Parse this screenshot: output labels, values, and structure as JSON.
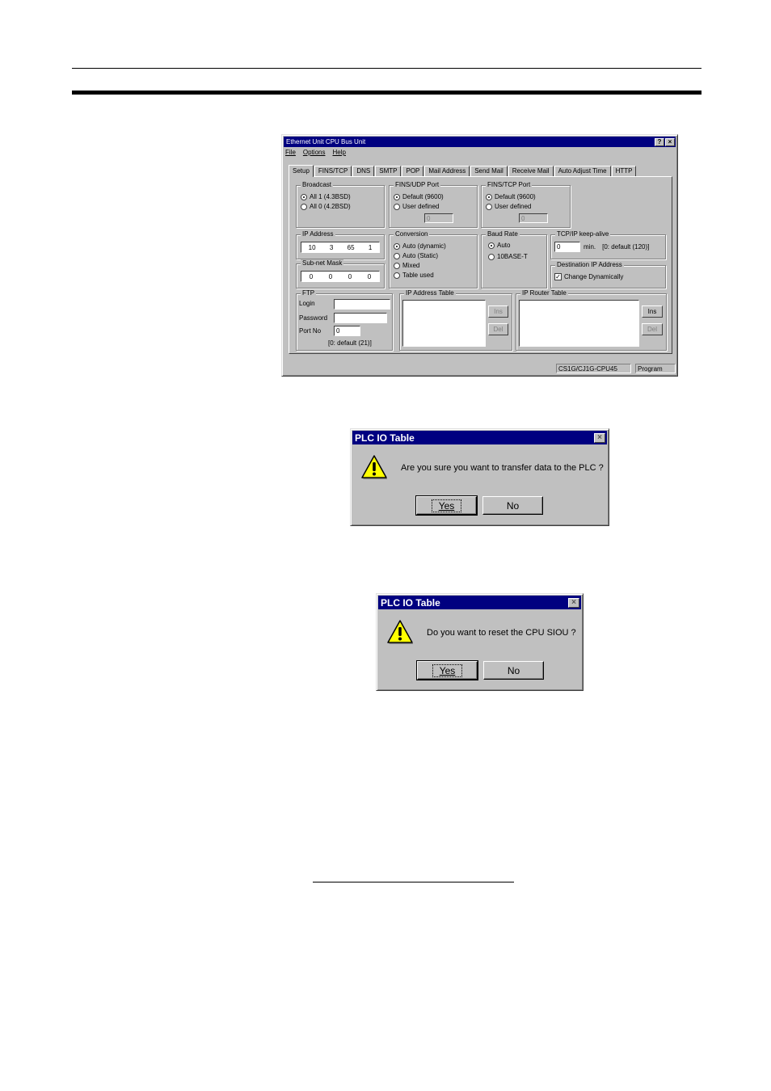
{
  "main_window": {
    "title": "Ethernet Unit CPU Bus Unit",
    "title_buttons": [
      "?",
      "×"
    ],
    "menu": [
      "File",
      "Options",
      "Help"
    ],
    "tabs": [
      "Setup",
      "FINS/TCP",
      "DNS",
      "SMTP",
      "POP",
      "Mail Address",
      "Send Mail",
      "Receive Mail",
      "Auto Adjust Time",
      "HTTP"
    ],
    "active_tab": "Setup",
    "broadcast": {
      "label": "Broadcast",
      "opt1": "All 1 (4.3BSD)",
      "opt2": "All 0 (4.2BSD)",
      "selected": "All 1 (4.3BSD)"
    },
    "fins_udp": {
      "label": "FINS/UDP Port",
      "opt1": "Default (9600)",
      "opt2": "User defined",
      "value": "0"
    },
    "fins_tcp": {
      "label": "FINS/TCP Port",
      "opt1": "Default (9600)",
      "opt2": "User defined",
      "value": "0"
    },
    "ip_address": {
      "label": "IP Address",
      "octets": [
        "10",
        "3",
        "65",
        "1"
      ]
    },
    "subnet_mask": {
      "label": "Sub-net Mask",
      "octets": [
        "0",
        "0",
        "0",
        "0"
      ]
    },
    "conversion": {
      "label": "Conversion",
      "options": [
        "Auto (dynamic)",
        "Auto (Static)",
        "Mixed",
        "Table used"
      ],
      "selected": "Auto (dynamic)"
    },
    "baud_rate": {
      "label": "Baud Rate",
      "opt1": "Auto",
      "opt2": "10BASE-T",
      "selected": "Auto"
    },
    "keepalive": {
      "label": "TCP/IP keep-alive",
      "value": "0",
      "unit": "min.",
      "hint": "[0: default (120)]"
    },
    "dest_ip": {
      "label": "Destination IP Address",
      "check_label": "Change Dynamically",
      "checked": true
    },
    "ftp": {
      "label": "FTP",
      "login_label": "Login",
      "password_label": "Password",
      "port_label": "Port No",
      "port_value": "0",
      "port_hint": "[0: default (21)]"
    },
    "ip_address_table": {
      "label": "IP Address Table",
      "ins": "Ins",
      "del": "Del"
    },
    "ip_router_table": {
      "label": "IP Router Table",
      "ins": "Ins",
      "del": "Del"
    },
    "status": {
      "model": "CS1G/CJ1G-CPU45",
      "mode": "Program"
    }
  },
  "dialog1": {
    "title": "PLC IO Table",
    "close": "×",
    "message": "Are you sure you want to transfer data to the PLC ?",
    "yes": "Yes",
    "no": "No"
  },
  "dialog2": {
    "title": "PLC IO Table",
    "close": "×",
    "message": "Do you want to reset the CPU SIOU ?",
    "yes": "Yes",
    "no": "No"
  },
  "colors": {
    "titlebar": "#000080",
    "face": "#c0c0c0",
    "warning_fill": "#ffff00"
  }
}
